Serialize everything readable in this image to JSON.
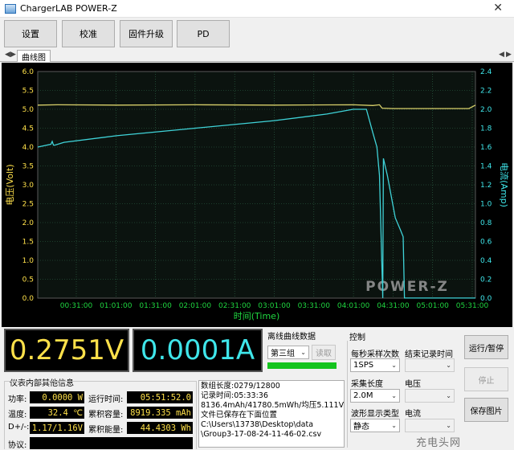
{
  "window": {
    "title": "ChargerLAB POWER-Z"
  },
  "toolbar": {
    "settings": "设置",
    "calibrate": "校准",
    "firmware": "固件升级",
    "pd": "PD"
  },
  "tabs": [
    "曲线图"
  ],
  "chart_data": {
    "type": "line",
    "xlabel": "时间(Time)",
    "ylabel_left": "电压(Volt)",
    "ylabel_right": "电流(Amp)",
    "ylim_left": [
      0,
      6.0
    ],
    "ylim_right": [
      0,
      2.4
    ],
    "yticks_left": [
      "0.0",
      "0.5",
      "1.0",
      "1.5",
      "2.0",
      "2.5",
      "3.0",
      "3.5",
      "4.0",
      "4.5",
      "5.0",
      "5.5",
      "6.0"
    ],
    "yticks_right": [
      "0.0",
      "0.2",
      "0.4",
      "0.6",
      "0.8",
      "1.0",
      "1.2",
      "1.4",
      "1.6",
      "1.8",
      "2.0",
      "2.2",
      "2.4"
    ],
    "xticks": [
      "00:31:00",
      "01:01:00",
      "01:31:00",
      "02:01:00",
      "02:31:00",
      "03:01:00",
      "03:31:00",
      "04:01:00",
      "04:31:00",
      "05:01:00",
      "05:31:00"
    ],
    "grid": true,
    "watermark": "POWER-Z",
    "colors": {
      "voltage": "#d8d06a",
      "current": "#3fd3d8",
      "grid": "#2f6a4a",
      "axis_left": "#ffe14a",
      "axis_right": "#3fe6ea",
      "background": "#000000"
    },
    "series": [
      {
        "name": "电压(Volt)",
        "axis": "left",
        "x_minutes": [
          0,
          15,
          60,
          120,
          180,
          240,
          255,
          260,
          262,
          270,
          300,
          328,
          333
        ],
        "y": [
          5.11,
          5.12,
          5.11,
          5.12,
          5.11,
          5.12,
          5.1,
          5.12,
          5.03,
          5.02,
          5.02,
          5.02,
          5.11
        ]
      },
      {
        "name": "电流(Amp)",
        "axis": "right",
        "x_minutes": [
          0,
          10,
          11,
          12,
          13,
          20,
          60,
          120,
          180,
          220,
          240,
          250,
          255,
          258,
          260,
          262,
          262.5,
          263,
          266,
          272,
          276,
          278,
          279,
          333
        ],
        "y": [
          1.6,
          1.63,
          1.66,
          1.62,
          1.62,
          1.65,
          1.72,
          1.8,
          1.88,
          1.95,
          2.0,
          2.0,
          1.75,
          1.6,
          1.3,
          0.25,
          0.001,
          1.48,
          1.3,
          0.85,
          0.72,
          0.65,
          0.001,
          0.001
        ]
      }
    ]
  },
  "readouts": {
    "voltage": "0.2751V",
    "current": "0.0001A"
  },
  "offline": {
    "title": "离线曲线数据",
    "group_value": "第三组",
    "read_button": "读取"
  },
  "control": {
    "title": "控制",
    "sample_rate_label": "每秒采样次数",
    "sample_rate_value": "1SPS",
    "end_time_label": "结束记录时间",
    "end_time_value": "",
    "length_label": "采集长度",
    "length_value": "2.0M",
    "voltage_label": "电压",
    "voltage_value": "",
    "waveform_label": "波形显示类型",
    "waveform_value": "静态",
    "current_label": "电流",
    "current_value": ""
  },
  "buttons": {
    "run_pause": "运行/暂停",
    "stop": "停止",
    "save_image": "保存图片"
  },
  "meter": {
    "title": "仪表内部其他信息",
    "power_label": "功率:",
    "power_value": "0.0000 W",
    "runtime_label": "运行时间:",
    "runtime_value": "05:51:52.0",
    "temp_label": "温度:",
    "temp_value": "32.4 ℃",
    "capacity_label": "累积容量:",
    "capacity_value": "8919.335 mAh",
    "dpdm_label": "D+/-:",
    "dpdm_value": "1.17/1.16V",
    "energy_label": "累积能量:",
    "energy_value": "44.4303 Wh",
    "protocol_label": "协议:"
  },
  "info": [
    "数组长度:0279/12800",
    "记录时间:05:33:36",
    "8136.4mAh/41780.5mWh/均压5.111V",
    "文件已保存在下面位置",
    "C:\\Users\\13738\\Desktop\\data",
    "\\Group3-17-08-24-11-46-02.csv"
  ],
  "watermark_bottom": "充电头网"
}
